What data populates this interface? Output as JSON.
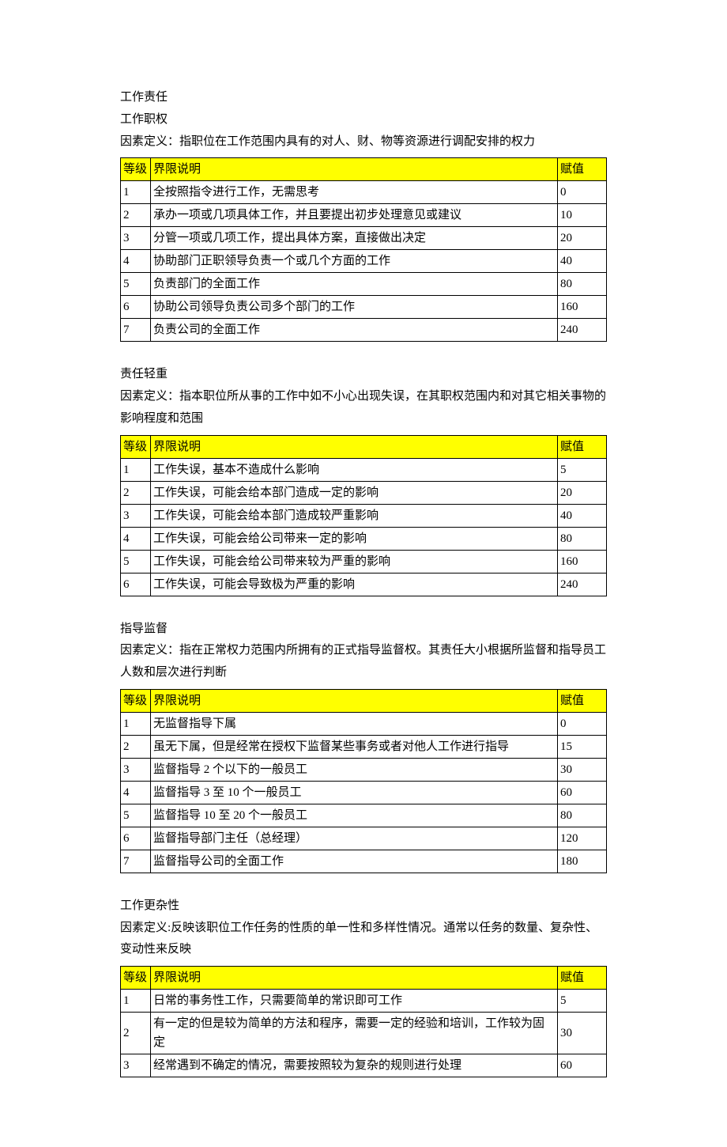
{
  "headers": {
    "level": "等级",
    "desc": "界限说明",
    "value": "赋值"
  },
  "sections": [
    {
      "preheading": "工作责任",
      "heading": "工作职权",
      "definition": "因素定义：指职位在工作范围内具有的对人、财、物等资源进行调配安排的权力",
      "rows": [
        {
          "level": "1",
          "desc": "全按照指令进行工作，无需思考",
          "value": "0"
        },
        {
          "level": "2",
          "desc": "承办一项或几项具体工作，并且要提出初步处理意见或建议",
          "value": "10"
        },
        {
          "level": "3",
          "desc": "分管一项或几项工作，提出具体方案，直接做出决定",
          "value": "20"
        },
        {
          "level": "4",
          "desc": "协助部门正职领导负责一个或几个方面的工作",
          "value": "40"
        },
        {
          "level": "5",
          "desc": "负责部门的全面工作",
          "value": "80"
        },
        {
          "level": "6",
          "desc": "协助公司领导负责公司多个部门的工作",
          "value": "160"
        },
        {
          "level": "7",
          "desc": "负责公司的全面工作",
          "value": "240"
        }
      ]
    },
    {
      "heading": "责任轻重",
      "definition": "因素定义：指本职位所从事的工作中如不小心出现失误，在其职权范围内和对其它相关事物的影响程度和范围",
      "rows": [
        {
          "level": "1",
          "desc": "工作失误，基本不造成什么影响",
          "value": "5"
        },
        {
          "level": "2",
          "desc": "工作失误，可能会给本部门造成一定的影响",
          "value": "20"
        },
        {
          "level": "3",
          "desc": "工作失误，可能会给本部门造成较严重影响",
          "value": "40"
        },
        {
          "level": "4",
          "desc": "工作失误，可能会给公司带来一定的影响",
          "value": "80"
        },
        {
          "level": "5",
          "desc": "工作失误，可能会给公司带来较为严重的影响",
          "value": "160"
        },
        {
          "level": "6",
          "desc": "工作失误，可能会导致极为严重的影响",
          "value": "240"
        }
      ]
    },
    {
      "heading": "指导监督",
      "definition": "因素定义：指在正常权力范围内所拥有的正式指导监督权。其责任大小根据所监督和指导员工人数和层次进行判断",
      "rows": [
        {
          "level": "1",
          "desc": "无监督指导下属",
          "value": "0"
        },
        {
          "level": "2",
          "desc": "虽无下属，但是经常在授权下监督某些事务或者对他人工作进行指导",
          "value": "15"
        },
        {
          "level": "3",
          "desc": "监督指导 2 个以下的一般员工",
          "value": "30"
        },
        {
          "level": "4",
          "desc": "监督指导 3 至 10 个一般员工",
          "value": "60"
        },
        {
          "level": "5",
          "desc": "监督指导 10 至 20 个一般员工",
          "value": "80"
        },
        {
          "level": "6",
          "desc": "监督指导部门主任（总经理）",
          "value": "120"
        },
        {
          "level": "7",
          "desc": "监督指导公司的全面工作",
          "value": "180"
        }
      ]
    },
    {
      "heading": "工作更杂性",
      "definition": "因素定义:反映该职位工作任务的性质的单一性和多样性情况。通常以任务的数量、复杂性、变动性来反映",
      "rows": [
        {
          "level": "1",
          "desc": "日常的事务性工作，只需要简单的常识即可工作",
          "value": "5"
        },
        {
          "level": "2",
          "desc": "有一定的但是较为简单的方法和程序，需要一定的经验和培训，工作较为固定",
          "value": "30"
        },
        {
          "level": "3",
          "desc": "经常遇到不确定的情况，需要按照较为复杂的规则进行处理",
          "value": "60"
        }
      ]
    }
  ]
}
